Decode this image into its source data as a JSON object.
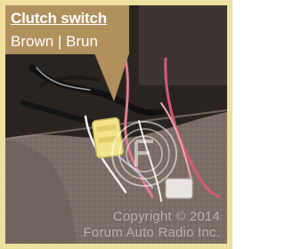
{
  "callout": {
    "title": "Clutch switch",
    "subtitle": "Brown | Brun"
  },
  "watermark": {
    "line1": "Copyright © 2014",
    "line2": "Forum Auto Radio Inc."
  },
  "colors": {
    "callout_bg": "#b1905e",
    "frame": "#efe0a0",
    "connector": "#f3e489",
    "carpet": "#7d6f68"
  },
  "icons": {
    "watermark_logo": "far-logo-icon"
  }
}
